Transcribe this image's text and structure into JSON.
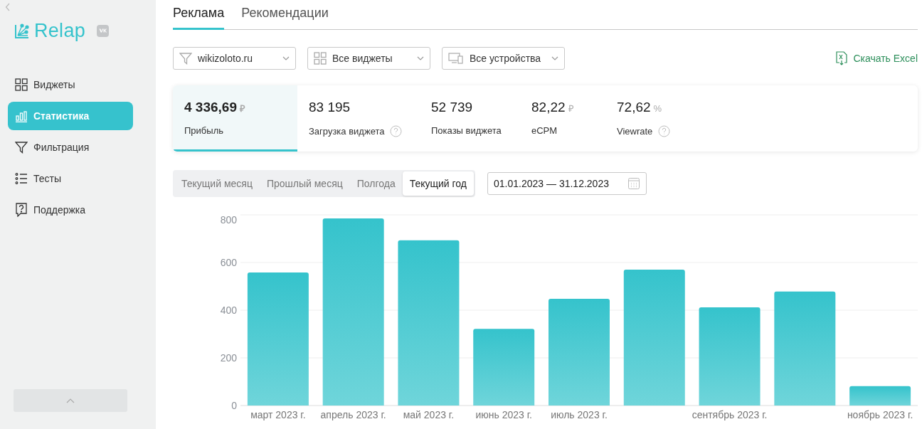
{
  "sidebar": {
    "logo": "Relap",
    "items": [
      {
        "label": "Виджеты",
        "selected": false
      },
      {
        "label": "Статистика",
        "selected": true
      },
      {
        "label": "Фильтрация",
        "selected": false
      },
      {
        "label": "Тесты",
        "selected": false
      },
      {
        "label": "Поддержка",
        "selected": false
      }
    ]
  },
  "tabs": [
    {
      "label": "Реклама",
      "selected": true
    },
    {
      "label": "Рекомендации",
      "selected": false
    }
  ],
  "filters": [
    {
      "value": "wikizoloto.ru"
    },
    {
      "value": "Все виджеты"
    },
    {
      "value": "Все устройства"
    }
  ],
  "download_link": "Скачать Excel",
  "stats": [
    {
      "value": "4 336,69",
      "unit": "₽",
      "label": "Прибыль",
      "help": false,
      "selected": true
    },
    {
      "value": "83 195",
      "label": "Загрузка виджета",
      "help": true,
      "selected": false
    },
    {
      "value": "52 739",
      "label": "Показы виджета",
      "help": false,
      "selected": false
    },
    {
      "value": "82,22",
      "unit": "₽",
      "label": "eCPM",
      "help": false,
      "selected": false
    },
    {
      "value": "72,62",
      "unit": "%",
      "label": "Viewrate",
      "help": true,
      "selected": false
    }
  ],
  "periods": [
    {
      "label": "Текущий месяц",
      "selected": false
    },
    {
      "label": "Прошлый месяц",
      "selected": false
    },
    {
      "label": "Полгода",
      "selected": false
    },
    {
      "label": "Текущий год",
      "selected": true
    }
  ],
  "date_range": "01.01.2023 — 31.12.2023",
  "chart_data": {
    "type": "bar",
    "categories": [
      "март 2023 г.",
      "апрель 2023 г.",
      "май 2023 г.",
      "июнь 2023 г.",
      "июль 2023 г.",
      null,
      "сентябрь 2023 г.",
      null,
      "ноябрь 2023 г."
    ],
    "values": [
      558,
      785,
      693,
      322,
      448,
      570,
      412,
      478,
      81
    ],
    "ylim": [
      0,
      800
    ],
    "yticks": [
      0,
      200,
      400,
      600,
      800
    ],
    "grid": true
  }
}
